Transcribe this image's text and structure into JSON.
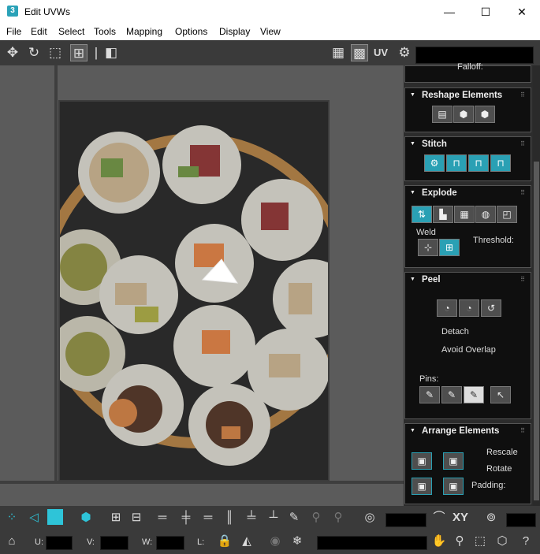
{
  "window": {
    "title": "Edit UVWs",
    "app_icon": "3",
    "minimize": "—",
    "maximize": "☐",
    "close": "✕"
  },
  "menu": [
    "File",
    "Edit",
    "Select",
    "Tools",
    "Mapping",
    "Options",
    "Display",
    "View"
  ],
  "toolbar": {
    "uv_label": "UV"
  },
  "panel": {
    "falloff_label": "Falloff:",
    "reshape": {
      "title": "Reshape Elements"
    },
    "stitch": {
      "title": "Stitch"
    },
    "explode": {
      "title": "Explode",
      "weld_label": "Weld",
      "threshold_label": "Threshold:"
    },
    "peel": {
      "title": "Peel",
      "detach_label": "Detach",
      "avoid_overlap_label": "Avoid Overlap",
      "pins_label": "Pins:"
    },
    "arrange": {
      "title": "Arrange Elements",
      "rescale_label": "Rescale",
      "rotate_label": "Rotate",
      "padding_label": "Padding:"
    }
  },
  "bottombar": {
    "u_label": "U:",
    "v_label": "V:",
    "w_label": "W:",
    "l_label": "L:",
    "xy_label": "XY"
  },
  "colors": {
    "accent": "#2aa0b4",
    "panel_bg": "#0f0f0f",
    "viewport_bg": "#5b5b5b"
  }
}
